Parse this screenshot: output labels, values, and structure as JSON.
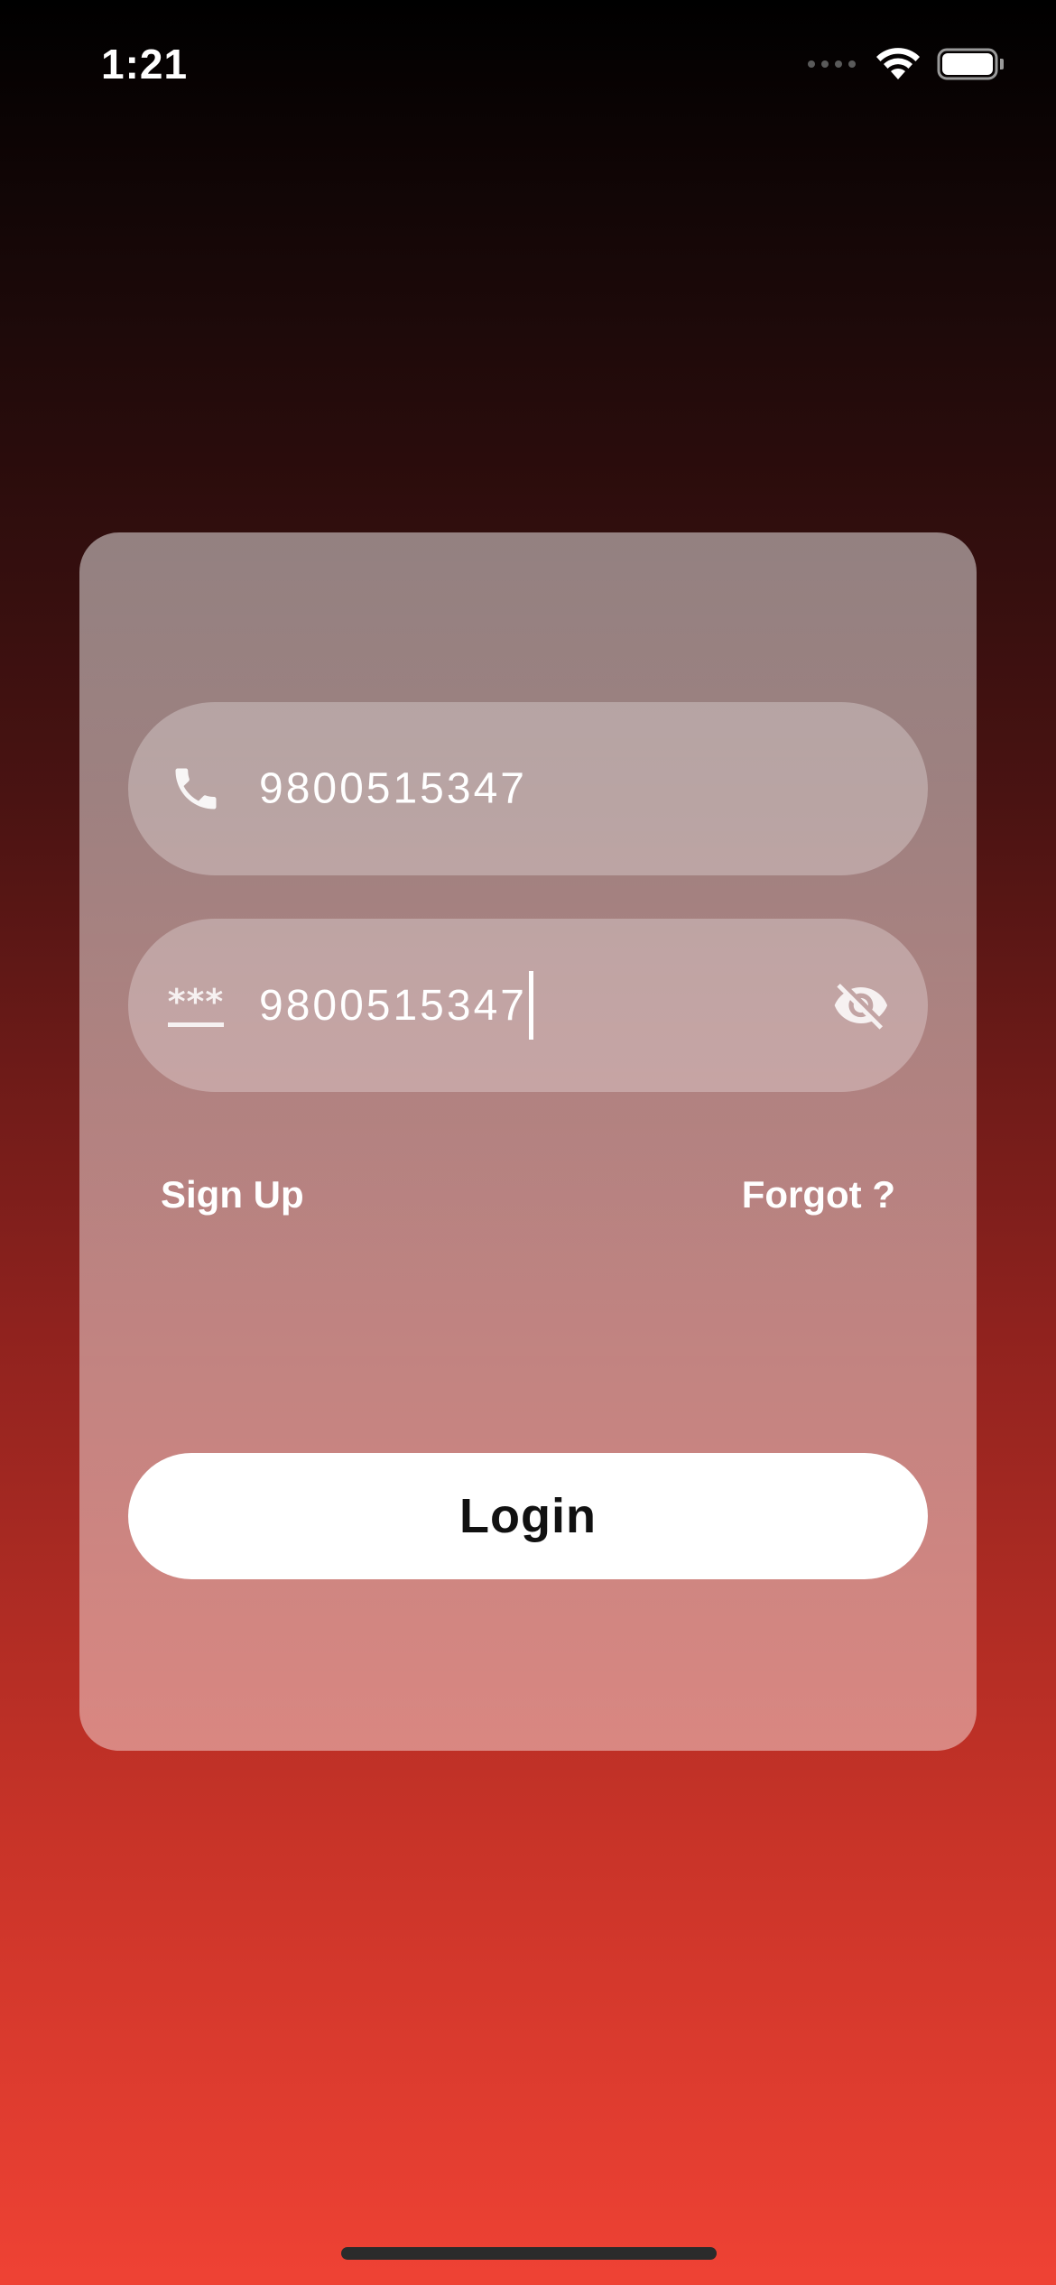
{
  "status_bar": {
    "time": "1:21",
    "icons": [
      "cellular-signal-icon",
      "wifi-icon",
      "battery-icon"
    ]
  },
  "login_form": {
    "phone_field": {
      "icon": "phone-icon",
      "value": "9800515347"
    },
    "password_field": {
      "icon": "password-stars-icon",
      "icon_text": "***",
      "value": "9800515347",
      "visibility_toggle_icon": "eye-off-icon"
    },
    "sign_up_label": "Sign Up",
    "forgot_label": "Forgot ?",
    "login_label": "Login"
  },
  "colors": {
    "background_top": "#000000",
    "background_bottom": "#ef4234",
    "button_background": "#ffffff",
    "button_text": "#111111"
  }
}
